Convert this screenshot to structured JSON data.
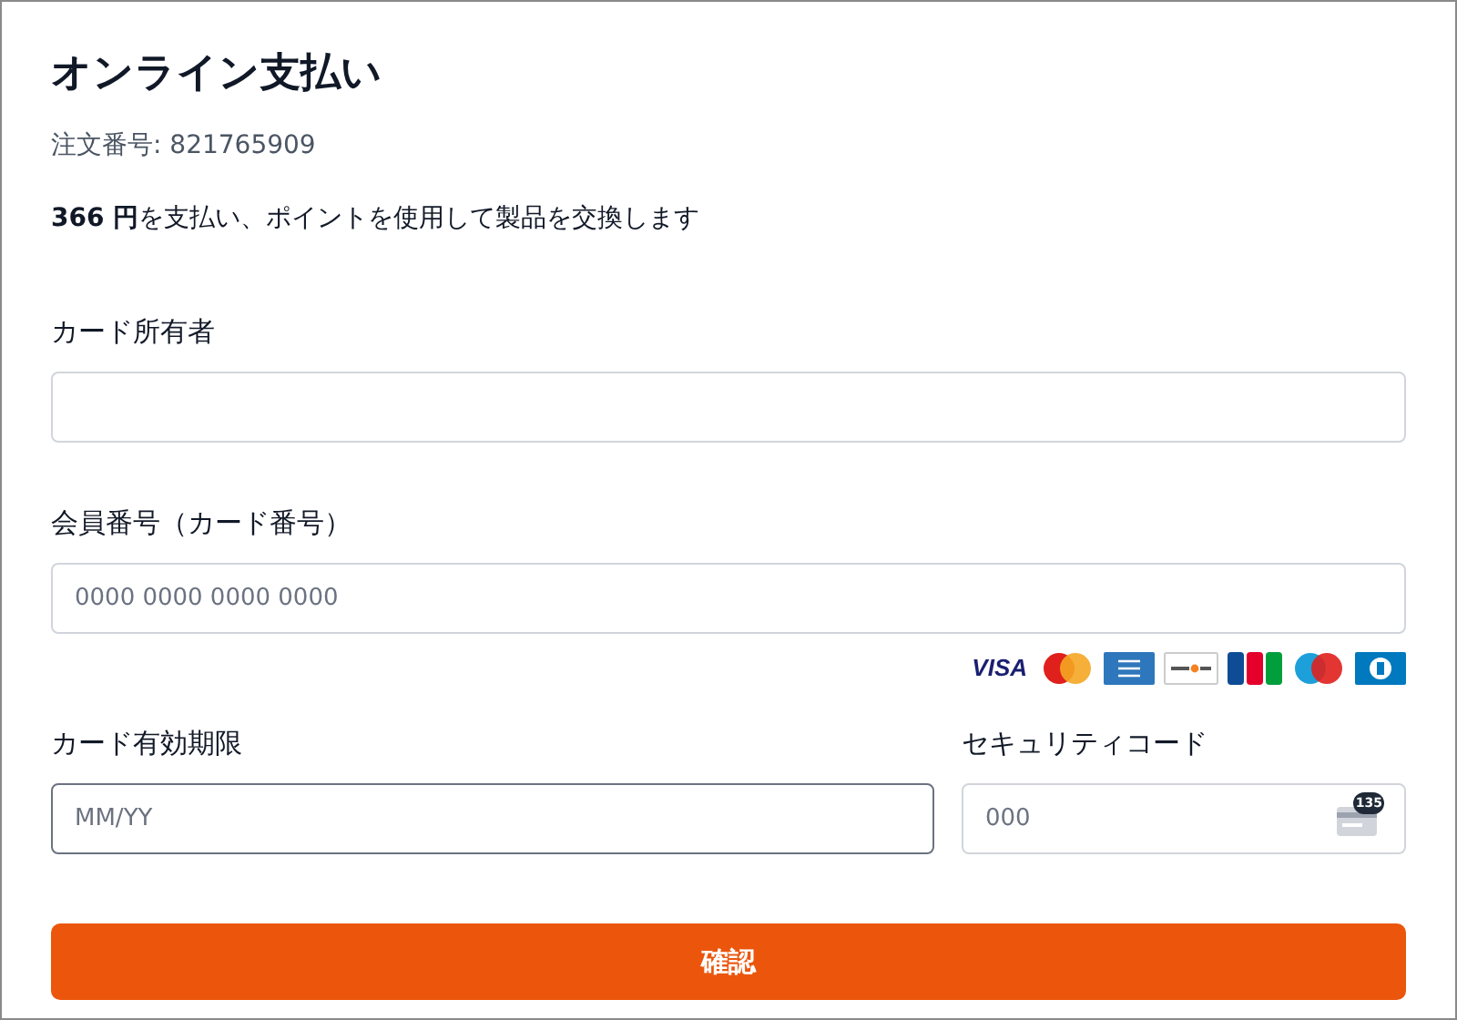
{
  "title": "オンライン支払い",
  "order_number": "注文番号: 821765909",
  "summary": "**366 円**を支払い、ポイントを使用して製品を交換します",
  "fields": [
    {
      "label": "カード所有者",
      "focused": false
    },
    {
      "label": "会員番号（カード番号）",
      "placeholder": "0000 0000 0000 0000",
      "focused": false
    }
  ],
  "card_brands": [
    {
      "kind": "visa",
      "text": "VISA"
    },
    {
      "kind": "mastercard"
    },
    {
      "kind": "amex"
    },
    {
      "kind": "discover"
    },
    {
      "kind": "jcb"
    },
    {
      "kind": "maestro"
    },
    {
      "kind": "diners"
    }
  ],
  "expiry": {
    "label": "カード有効期限",
    "placeholder": "MM/YY",
    "focused": true
  },
  "security_code": {
    "label": "セキュリティコード",
    "placeholder": "000",
    "icon_badge": "135"
  },
  "submit_button": "確認"
}
